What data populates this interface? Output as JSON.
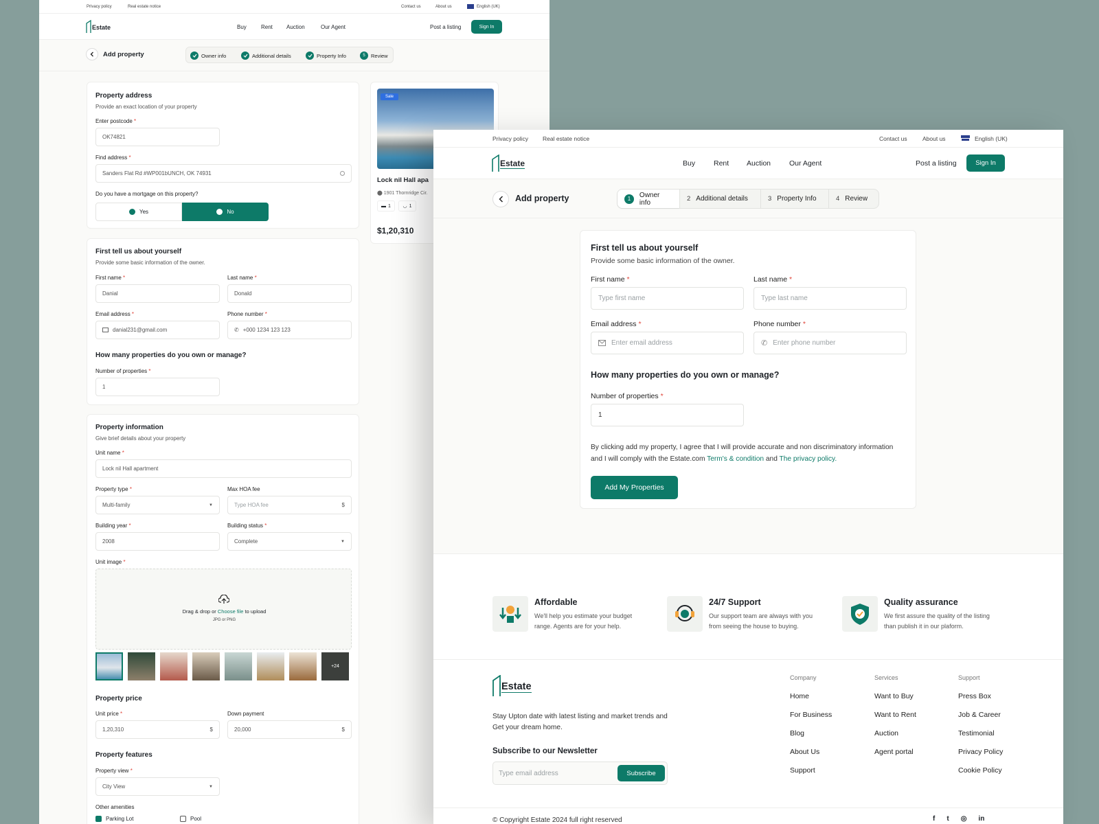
{
  "colors": {
    "accent": "#0d7a68",
    "page_bg": "#869e9b",
    "required": "#e0453a",
    "sale_badge": "#2f6fe0"
  },
  "util": {
    "privacy": "Privacy policy",
    "notice": "Real estate notice",
    "contact": "Contact us",
    "about": "About us",
    "lang": "English (UK)"
  },
  "nav": {
    "brand": "Estate",
    "items": [
      "Buy",
      "Rent",
      "Auction",
      "Our Agent"
    ],
    "post": "Post a listing",
    "signin": "Sign In"
  },
  "page": {
    "title": "Add property"
  },
  "steps": [
    {
      "num": "1",
      "label": "Owner info"
    },
    {
      "num": "2",
      "label": "Additional details"
    },
    {
      "num": "3",
      "label": "Property Info"
    },
    {
      "num": "4",
      "label": "Review"
    }
  ],
  "back_review_num": "5",
  "back": {
    "address": {
      "title": "Property address",
      "sub": "Provide an exact location of your property",
      "postcode_label": "Enter postcode",
      "postcode": "OK74821",
      "find_label": "Find address",
      "find": "Sanders Flat Rd #WP001bUNCH, OK 74931",
      "mortgage_q": "Do you have a mortgage on this property?",
      "yes": "Yes",
      "no": "No"
    },
    "owner": {
      "title": "First tell us about yourself",
      "sub": "Provide some basic information of the owner.",
      "first_label": "First name",
      "first": "Danial",
      "last_label": "Last name",
      "last": "Donald",
      "email_label": "Email address",
      "email": "danial231@gmail.com",
      "phone_label": "Phone number",
      "phone": "+000 1234 123 123",
      "q": "How many properties do you own or manage?",
      "num_label": "Number of properties",
      "num": "1"
    },
    "info": {
      "title": "Property information",
      "sub": "Give brief details about your property",
      "unit_label": "Unit name",
      "unit": "Lock nil Hall apartment",
      "type_label": "Property type",
      "type": "Multi-family",
      "hoa_label": "Max HOA fee",
      "hoa_ph": "Type HOA fee",
      "year_label": "Building year",
      "year": "2008",
      "status_label": "Building status",
      "status": "Complete",
      "img_label": "Unit image",
      "drag": "Drag & drop or",
      "choose": "Choose file",
      "upload": "to upload",
      "formats": "JPG or PNG",
      "more": "+24"
    },
    "price": {
      "title": "Property price",
      "unit_label": "Unit price",
      "unit": "1,20,310",
      "down_label": "Down payment",
      "down": "20,000"
    },
    "features": {
      "title": "Property features",
      "view_label": "Property view",
      "view": "City View",
      "amen_label": "Other amenities",
      "parking": "Parking Lot",
      "pool": "Pool"
    },
    "preview": {
      "badge": "Sale",
      "name": "Lock nil Hall apa",
      "addr": "1901 Thornridge Cir.",
      "beds": "1",
      "baths": "1",
      "price": "$1,20,310"
    }
  },
  "front": {
    "title": "First tell us about yourself",
    "sub": "Provide some basic information of the owner.",
    "first_label": "First name",
    "first_ph": "Type first name",
    "last_label": "Last name",
    "last_ph": "Type last name",
    "email_label": "Email address",
    "email_ph": "Enter email address",
    "phone_label": "Phone number",
    "phone_ph": "Enter phone number",
    "q": "How many properties do you own or manage?",
    "num_label": "Number of properties",
    "num": "1",
    "terms_a": "By clicking add my property, I agree that I will provide accurate and non discriminatory information and I will comply with the Estate.com",
    "terms_link": "Term's & condition",
    "and": "and",
    "privacy_link": "The privacy policy.",
    "cta": "Add My Properties"
  },
  "features": [
    {
      "title": "Affordable",
      "desc": "We'll help you estimate your budget range. Agents are for your help."
    },
    {
      "title": "24/7 Support",
      "desc": "Our support team are always with you from seeing the house to buying."
    },
    {
      "title": "Quality assurance",
      "desc": "We first assure the quality of the listing than publish it in our plaform."
    }
  ],
  "footer": {
    "tagline": "Stay Upton date with latest listing and market trends and Get your dream home.",
    "newsletter": "Subscribe to our Newsletter",
    "email_ph": "Type email address",
    "subscribe": "Subscribe",
    "company": {
      "head": "Company",
      "items": [
        "Home",
        "For Business",
        "Blog",
        "About Us",
        "Support"
      ]
    },
    "services": {
      "head": "Services",
      "items": [
        "Want to Buy",
        "Want to Rent",
        "Auction",
        "Agent portal"
      ]
    },
    "support": {
      "head": "Support",
      "items": [
        "Press Box",
        "Job & Career",
        "Testimonial",
        "Privacy Policy",
        "Cookie Policy"
      ]
    },
    "copyright": "© Copyright Estate 2024 full right reserved"
  }
}
